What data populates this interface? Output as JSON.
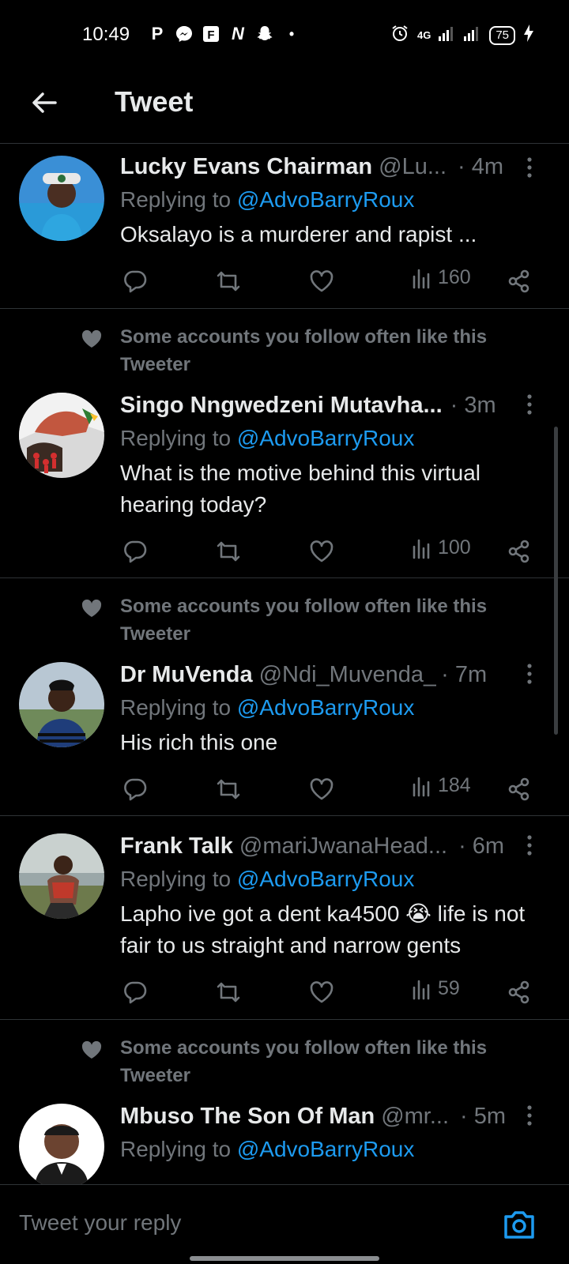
{
  "status_bar": {
    "time": "10:49",
    "notif_icons": [
      "P",
      "messenger",
      "F",
      "N",
      "snapchat",
      "•"
    ],
    "network": "4G",
    "battery": "75"
  },
  "header": {
    "title": "Tweet"
  },
  "tweets": [
    {
      "social_context": "",
      "name": "Lucky Evans Chairman",
      "handle": "@Lu...",
      "time": "· 4m",
      "replying_prefix": "Replying to ",
      "replying_to": "@AdvoBarryRoux",
      "text": "Oksalayo is a murderer and rapist ...",
      "views": "160"
    },
    {
      "social_context": "Some accounts you follow often like this Tweeter",
      "name": "Singo Nngwedzeni Mutavha...",
      "handle": "",
      "time": "· 3m",
      "replying_prefix": "Replying to ",
      "replying_to": "@AdvoBarryRoux",
      "text": "What is the motive behind this virtual hearing today?",
      "views": "100"
    },
    {
      "social_context": "Some accounts you follow often like this Tweeter",
      "name": "Dr MuVenda",
      "handle": "@Ndi_Muvenda_",
      "time": "· 7m",
      "replying_prefix": "Replying to ",
      "replying_to": "@AdvoBarryRoux",
      "text": "His rich this one",
      "views": "184"
    },
    {
      "social_context": "",
      "name": "Frank Talk",
      "handle": "@mariJwanaHead...",
      "time": "· 6m",
      "replying_prefix": "Replying to ",
      "replying_to": "@AdvoBarryRoux",
      "text": "Lapho ive got a dent ka4500 😭 life is not fair to us straight and narrow gents",
      "views": "59"
    },
    {
      "social_context": "Some accounts you follow often like this Tweeter",
      "name": "Mbuso The Son Of Man",
      "handle": "@mr...",
      "time": "· 5m",
      "replying_prefix": "Replying to ",
      "replying_to": "@AdvoBarryRoux",
      "text": "",
      "views": ""
    }
  ],
  "reply_bar": {
    "placeholder": "Tweet your reply"
  },
  "colors": {
    "background": "#000000",
    "accent": "#1d9bf0",
    "muted": "#71767b",
    "divider": "#2f3336"
  }
}
